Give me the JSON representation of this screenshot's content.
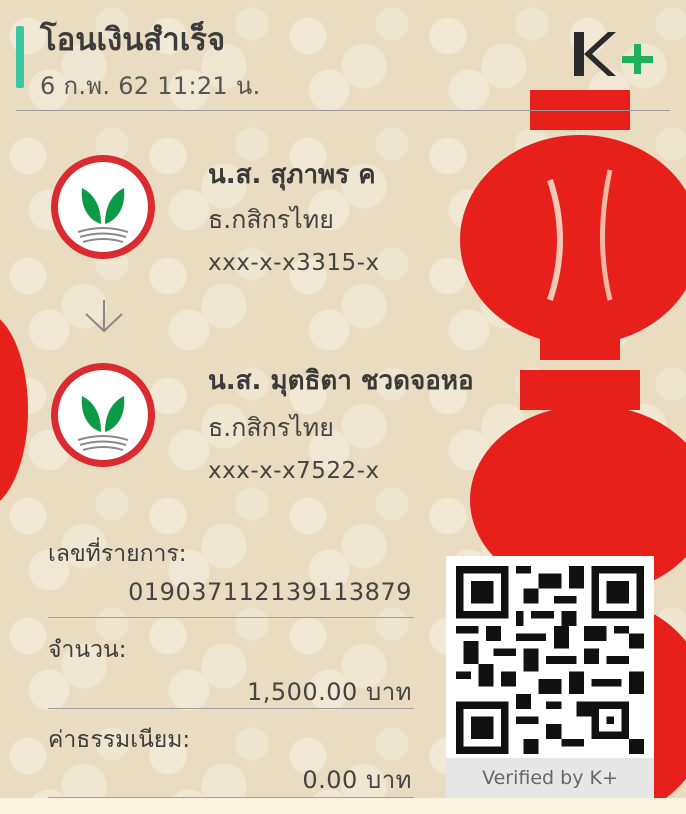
{
  "header": {
    "title": "โอนเงินสำเร็จ",
    "datetime": "6 ก.พ. 62  11:21 น.",
    "logo_icon": "kplus-logo"
  },
  "sender": {
    "name": "น.ส. สุภาพร ค",
    "bank": "ธ.กสิกรไทย",
    "account": "xxx-x-x3315-x",
    "logo_icon": "kasikorn-bank-logo"
  },
  "receiver": {
    "name": "น.ส. มุตธิตา ชวดจอหอ",
    "bank": "ธ.กสิกรไทย",
    "account": "xxx-x-x7522-x",
    "logo_icon": "kasikorn-bank-logo"
  },
  "details": {
    "ref_label": "เลขที่รายการ:",
    "ref_value": "019037112139113879",
    "amount_label": "จำนวน:",
    "amount_value": "1,500.00 บาท",
    "fee_label": "ค่าธรรมเนียม:",
    "fee_value": "0.00 บาท"
  },
  "qr": {
    "caption": "Verified by K+"
  },
  "colors": {
    "accent": "#3dc6a3",
    "kplus_green": "#1fb25a",
    "kplus_dark": "#2b2b2b",
    "kbank_green": "#0c9a47",
    "kbank_red": "#d92b30",
    "lantern_red": "#e8201c",
    "background": "#e9dcc0"
  }
}
